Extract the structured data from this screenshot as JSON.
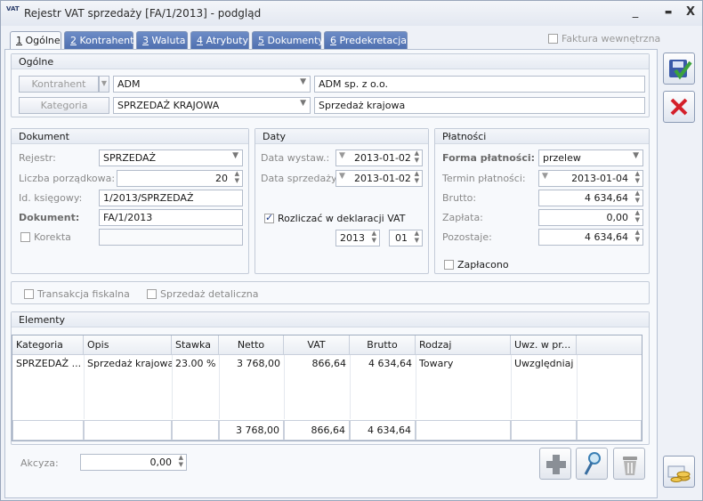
{
  "window": {
    "app_icon": "VAT",
    "title": "Rejestr VAT sprzedaży [FA/1/2013] - podgląd",
    "minimize": "_",
    "maximize": "▬",
    "close": "X"
  },
  "tabs": [
    {
      "num": "1",
      "label": " Ogólne"
    },
    {
      "num": "2",
      "label": " Kontrahent"
    },
    {
      "num": "3",
      "label": " Waluta"
    },
    {
      "num": "4",
      "label": " Atrybuty"
    },
    {
      "num": "5",
      "label": " Dokumenty"
    },
    {
      "num": "6",
      "label": " Predekretacja"
    }
  ],
  "faktura_wewnetrzna": "Faktura wewnętrzna",
  "ogolne": {
    "title": "Ogólne",
    "kontrahent_btn": "Kontrahent",
    "kontrahent_code": "ADM",
    "kontrahent_name": "ADM sp. z o.o.",
    "kategoria_btn": "Kategoria",
    "kategoria_code": "SPRZEDAŻ KRAJOWA",
    "kategoria_name": "Sprzedaż krajowa"
  },
  "dokument": {
    "title": "Dokument",
    "rejestr_label": "Rejestr:",
    "rejestr_value": "SPRZEDAŻ",
    "lp_label": "Liczba porządkowa:",
    "lp_value": "20",
    "id_label": "Id. księgowy:",
    "id_value": "1/2013/SPRZEDAŻ",
    "dok_label": "Dokument:",
    "dok_value": "FA/1/2013",
    "korekta_label": "Korekta",
    "korekta_value": ""
  },
  "daty": {
    "title": "Daty",
    "wystaw_label": "Data wystaw.:",
    "wystaw_value": "2013-01-02",
    "sprzedazy_label": "Data sprzedaży:",
    "sprzedazy_value": "2013-01-02",
    "rozliczac_label": "Rozliczać w deklaracji VAT",
    "rok": "2013",
    "miesiac": "01"
  },
  "platnosci": {
    "title": "Płatności",
    "forma_label": "Forma płatności:",
    "forma_value": "przelew",
    "termin_label": "Termin płatności:",
    "termin_value": "2013-01-04",
    "brutto_label": "Brutto:",
    "brutto_value": "4 634,64",
    "zaplata_label": "Zapłata:",
    "zaplata_value": "0,00",
    "pozostaje_label": "Pozostaje:",
    "pozostaje_value": "4 634,64",
    "zaplacono_label": "Zapłacono"
  },
  "transakcja_fiskalna": "Transakcja fiskalna",
  "sprzedaz_detaliczna": "Sprzedaż detaliczna",
  "elementy": {
    "title": "Elementy",
    "columns": [
      "Kategoria",
      "Opis",
      "Stawka",
      "Netto",
      "VAT",
      "Brutto",
      "Rodzaj",
      "Uwz. w pr..."
    ],
    "rows": [
      {
        "kategoria": "SPRZEDAŻ ...",
        "opis": "Sprzedaż krajowa",
        "stawka": "23.00 %",
        "netto": "3 768,00",
        "vat": "866,64",
        "brutto": "4 634,64",
        "rodzaj": "Towary",
        "uwz": "Uwzględniaj"
      }
    ],
    "totals": {
      "netto": "3 768,00",
      "vat": "866,64",
      "brutto": "4 634,64"
    }
  },
  "akcyza": {
    "label": "Akcyza:",
    "value": "0,00"
  },
  "icons": {
    "save": "save-icon",
    "cancel": "close-icon",
    "add": "plus-icon",
    "edit": "edit-icon",
    "delete": "trash-icon",
    "payments": "coins-icon"
  }
}
